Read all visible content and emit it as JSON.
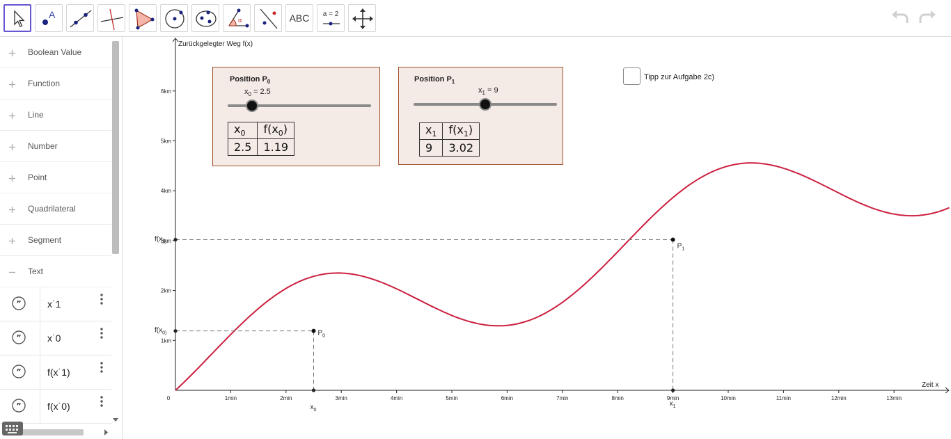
{
  "toolbar": {
    "tools": [
      {
        "name": "move-tool"
      },
      {
        "name": "point-tool"
      },
      {
        "name": "line-tool"
      },
      {
        "name": "perpendicular-line-tool"
      },
      {
        "name": "polygon-tool"
      },
      {
        "name": "circle-tool"
      },
      {
        "name": "ellipse-tool"
      },
      {
        "name": "angle-tool"
      },
      {
        "name": "reflect-tool"
      },
      {
        "name": "text-tool",
        "label": "ABC"
      },
      {
        "name": "slider-tool",
        "label": "a = 2"
      },
      {
        "name": "move-graphics-view-tool"
      }
    ]
  },
  "algebra": {
    "categories": [
      {
        "label": "Boolean Value",
        "expanded": false
      },
      {
        "label": "Function",
        "expanded": false
      },
      {
        "label": "Line",
        "expanded": false
      },
      {
        "label": "Number",
        "expanded": false
      },
      {
        "label": "Point",
        "expanded": false
      },
      {
        "label": "Quadrilateral",
        "expanded": false
      },
      {
        "label": "Segment",
        "expanded": false
      },
      {
        "label": "Text",
        "expanded": true
      }
    ],
    "text_items": [
      {
        "label": "x˙1"
      },
      {
        "label": "x˙0"
      },
      {
        "label": "f(x˙1)"
      },
      {
        "label": "f(x˙0)"
      }
    ]
  },
  "graph": {
    "y_axis_title": "Zurückgelegter Weg f(x)",
    "x_axis_title": "Zeit x",
    "origin_label": "0",
    "x_ticks": [
      "1min",
      "2min",
      "3min",
      "4min",
      "5min",
      "6min",
      "7min",
      "8min",
      "9min",
      "10min",
      "11min",
      "12min",
      "13min"
    ],
    "y_ticks": [
      "1km",
      "2km",
      "3km",
      "4km",
      "5km",
      "6km"
    ],
    "curve_color": "#cc1f3e",
    "point_p0": {
      "label": "P",
      "sub": "0",
      "x": 2.5,
      "y": 1.19
    },
    "point_p1": {
      "label": "P",
      "sub": "1",
      "x": 9,
      "y": 3.02
    },
    "x0_label": "x",
    "x0_sub": "0",
    "x1_label": "x",
    "x1_sub": "1",
    "fx0_label": "f(x",
    "fx0_sub": "0",
    "fx1_label": "f(x",
    "fx1_sub": "1"
  },
  "panel0": {
    "title": "Position P",
    "title_sub": "0",
    "slider_name": "x",
    "slider_sub": "0",
    "slider_value": "2.5",
    "slider_fraction": 0.17,
    "table": {
      "head": [
        "x",
        "f(x"
      ],
      "head_sub": "0",
      "row": [
        "2.5",
        "1.19"
      ]
    }
  },
  "panel1": {
    "title": "Position P",
    "title_sub": "1",
    "slider_name": "x",
    "slider_sub": "1",
    "slider_value": "9",
    "slider_fraction": 0.5,
    "table": {
      "head": [
        "x",
        "f(x"
      ],
      "head_sub": "1",
      "row": [
        "9",
        "3.02"
      ]
    }
  },
  "hint": {
    "label": "Tipp zur Aufgabe 2c)",
    "checked": false
  }
}
